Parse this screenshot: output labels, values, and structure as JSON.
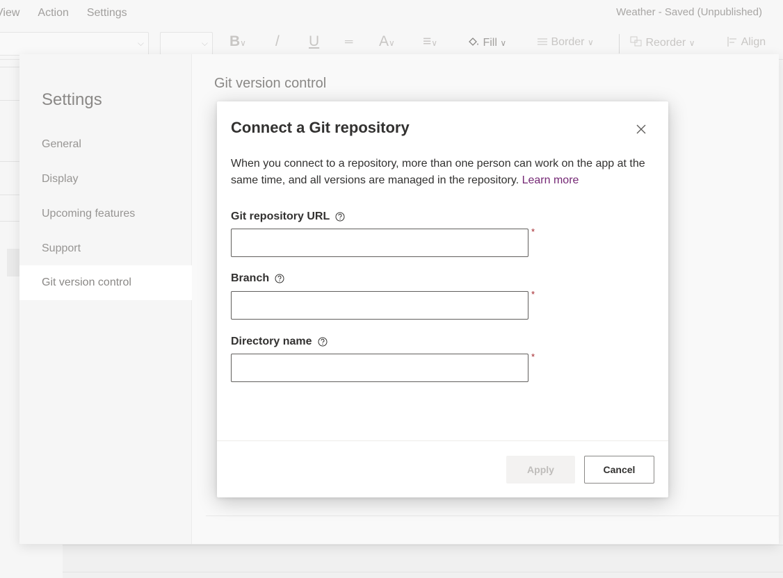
{
  "menubar": {
    "items": [
      "View",
      "Action",
      "Settings"
    ],
    "app_title": "Weather - Saved (Unpublished)"
  },
  "toolbar": {
    "bold": "B",
    "italic": "/",
    "underline": "U",
    "strikethrough": "═",
    "font_color": "A",
    "align_text": "≡",
    "fill_label": "Fill",
    "border_label": "Border",
    "reorder_label": "Reorder",
    "align_label": "Align",
    "chevron": "∨"
  },
  "settings": {
    "title": "Settings",
    "nav_items": [
      {
        "label": "General",
        "selected": false
      },
      {
        "label": "Display",
        "selected": false
      },
      {
        "label": "Upcoming features",
        "selected": false
      },
      {
        "label": "Support",
        "selected": false
      },
      {
        "label": "Git version control",
        "selected": true
      }
    ],
    "content_title": "Git version control"
  },
  "dialog": {
    "title": "Connect a Git repository",
    "description": "When you connect to a repository, more than one person can work on the app at the same time, and all versions are managed in the repository.",
    "learn_more": "Learn more",
    "fields": [
      {
        "label": "Git repository URL",
        "value": "",
        "required_mark": "*"
      },
      {
        "label": "Branch",
        "value": "",
        "required_mark": "*"
      },
      {
        "label": "Directory name",
        "value": "",
        "required_mark": "*"
      }
    ],
    "apply_label": "Apply",
    "cancel_label": "Cancel"
  },
  "colors": {
    "link": "#742774",
    "required": "#a4262c",
    "text": "#323130",
    "disabled_bg": "#f3f2f1"
  }
}
